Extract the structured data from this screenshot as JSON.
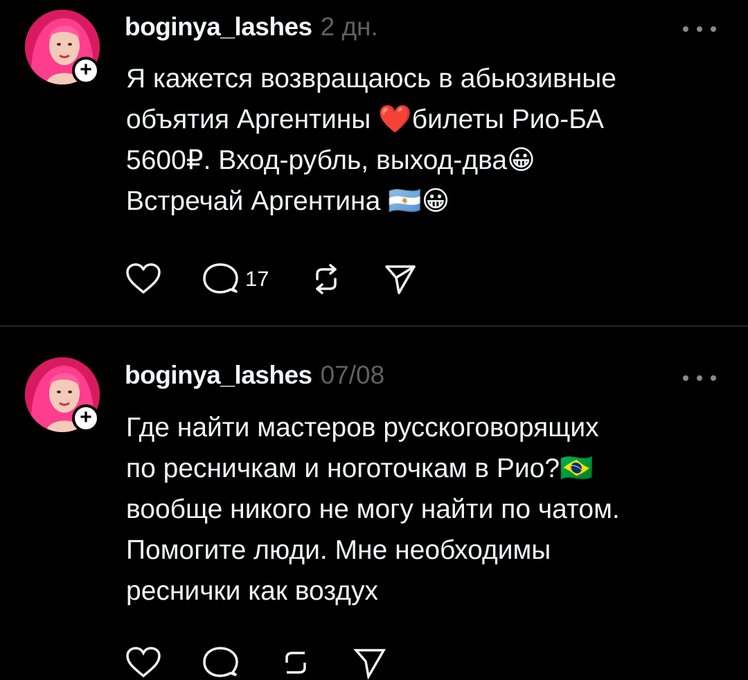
{
  "posts": [
    {
      "username": "boginya_lashes",
      "timestamp": "2 дн.",
      "text": "Я кажется возвращаюсь в абьюзивные\nобъятия Аргентины ❤️билеты Рио-БА\n5600₽. Вход-рубль, выход-два😀\nВстречай Аргентина 🇦🇷😀",
      "avatar_icon": "profile-photo",
      "follow_icon": "plus-icon",
      "follow_symbol": "+",
      "actions": {
        "like_icon": "heart-icon",
        "reply_icon": "speech-bubble-icon",
        "reply_count": "17",
        "repost_icon": "repost-icon",
        "share_icon": "send-icon"
      }
    },
    {
      "username": "boginya_lashes",
      "timestamp": "07/08",
      "text": "Где найти мастеров русскоговорящих\nпо ресничкам и ноготочкам в Рио?🇧🇷\nвообще никого не могу найти по чатом.\nПомогите люди. Мне необходимы\nреснички как воздух",
      "avatar_icon": "profile-photo",
      "follow_icon": "plus-icon",
      "follow_symbol": "+",
      "actions": {
        "like_icon": "heart-icon",
        "reply_icon": "speech-bubble-icon",
        "repost_icon": "repost-icon",
        "share_icon": "send-icon"
      }
    }
  ],
  "colors": {
    "background": "#000000",
    "text": "#f3f5f7",
    "muted": "#616161",
    "divider": "#262626",
    "avatar_hair": "#ff2f87"
  }
}
